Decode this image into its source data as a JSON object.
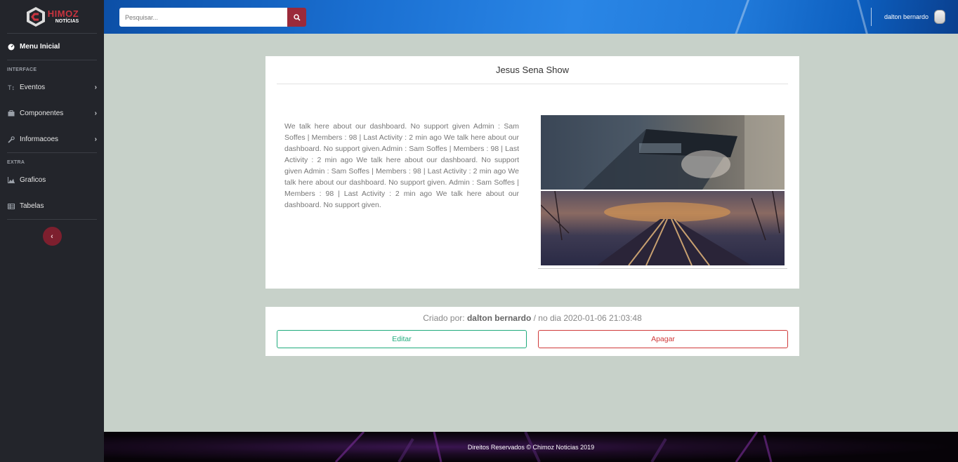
{
  "brand": {
    "name": "HIMOZ",
    "sub": "NOTÍCIAS"
  },
  "sidebar": {
    "menu_initial": "Menu Inicial",
    "section_interface": "INTERFACE",
    "items_interface": [
      {
        "label": "Eventos",
        "icon": "text-height-icon"
      },
      {
        "label": "Componentes",
        "icon": "briefcase-icon"
      },
      {
        "label": "Informacoes",
        "icon": "wrench-icon"
      }
    ],
    "section_extra": "EXTRA",
    "items_extra": [
      {
        "label": "Graficos",
        "icon": "area-chart-icon"
      },
      {
        "label": "Tabelas",
        "icon": "table-icon"
      }
    ],
    "toggle": "‹"
  },
  "topbar": {
    "search_placeholder": "Pesquisar...",
    "user_name": "dalton bernardo"
  },
  "post": {
    "title": "Jesus Sena Show",
    "body": "We talk here about our dashboard. No support given Admin : Sam Soffes | Members : 98 | Last Activity : 2 min ago We talk here about our dashboard. No support given.Admin : Sam Soffes | Members : 98 | Last Activity : 2 min ago We talk here about our dashboard. No support given Admin : Sam Soffes | Members : 98 | Last Activity : 2 min ago We talk here about our dashboard. No support given. Admin : Sam Soffes | Members : 98 | Last Activity : 2 min ago We talk here about our dashboard. No support given."
  },
  "meta": {
    "created_prefix": "Criado por:",
    "author": "dalton bernardo",
    "date_text": "/ no dia 2020-01-06 21:03:48"
  },
  "actions": {
    "edit": "Editar",
    "delete": "Apagar"
  },
  "footer": {
    "text": "Direitos Reservados © Chimoz Noticias 2019"
  },
  "colors": {
    "accent": "#9b2a3a",
    "edit": "#1fab7c",
    "delete": "#d03a3a",
    "sidebar": "#23252b",
    "page_bg": "#c7d1c9"
  }
}
